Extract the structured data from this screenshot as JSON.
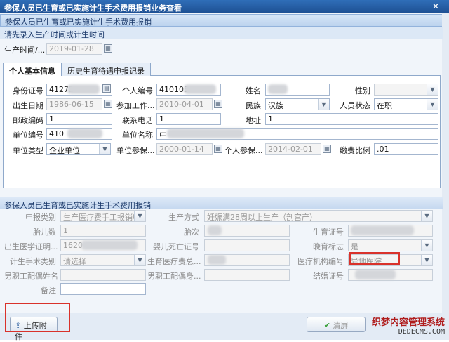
{
  "window": {
    "title": "参保人员已生育或已实施计生手术费用报销业务查看",
    "close_glyph": "✕"
  },
  "subtitle": "参保人员已生育或已实施计生手术费用报销",
  "hint": "请先录入生产时间或计生时间",
  "birth_time": {
    "label": "生产时间/...",
    "value": "2019-01-28"
  },
  "tabs": [
    {
      "label": "个人基本信息"
    },
    {
      "label": "历史生育待遇申报记录"
    }
  ],
  "personal": {
    "id_label": "身份证号",
    "id_value": "41272",
    "personno_label": "个人编号",
    "personno_value": "410105",
    "name_label": "姓名",
    "gender_label": "性别",
    "birthdate_label": "出生日期",
    "birthdate_value": "1986-06-15",
    "work_label": "参加工作...",
    "work_value": "2010-04-01",
    "ethnic_label": "民族",
    "ethnic_value": "汉族",
    "status_label": "人员状态",
    "status_value": "在职",
    "zip_label": "邮政编码",
    "zip_value": "1",
    "phone_label": "联系电话",
    "phone_value": "1",
    "addr_label": "地址",
    "addr_value": "1",
    "unitno_label": "单位编号",
    "unitno_value": "410",
    "unitname_label": "单位名称",
    "unitname_value": "中",
    "unittype_label": "单位类型",
    "unittype_value": "企业单位",
    "unitins_label": "单位参保...",
    "unitins_value": "2000-01-14",
    "personins_label": "个人参保...",
    "personins_value": "2014-02-01",
    "ratio_label": "缴费比例",
    "ratio_value": ".01"
  },
  "section2": {
    "title": "参保人员已生育或已实施计生手术费用报销"
  },
  "claim": {
    "type_label": "申报类别",
    "type_value": "生产医疗费手工报销申",
    "method_label": "生产方式",
    "method_value": "妊娠满28周以上生产（剖宫产）",
    "fetus_label": "胎儿数",
    "fetus_value": "1",
    "parity_label": "胎次",
    "birthcert_label": "生育证号",
    "medcert_label": "出生医学证明...",
    "medcert_value": "1620",
    "infantdeath_label": "婴儿死亡证号",
    "lateflag_label": "晚育标志",
    "lateflag_value": "是",
    "surgerytype_label": "计生手术类别",
    "surgerytype_value": "请选择",
    "birthcost_label": "生育医疗费总...",
    "hospital_label": "医疗机构编号",
    "hospital_value": "异地医院",
    "spouse_name_label": "男职工配偶姓名",
    "spouse_id_label": "男职工配偶身...",
    "marriage_label": "结婚证号",
    "remark_label": "备注"
  },
  "buttons": {
    "upload": "上传附件",
    "clear": "清屏"
  },
  "watermark": {
    "line1": "织梦内容管理系统",
    "line2": "DEDECMS.COM"
  },
  "colors": {
    "title_bar": "#1d4f92",
    "highlight": "#d9322b"
  }
}
